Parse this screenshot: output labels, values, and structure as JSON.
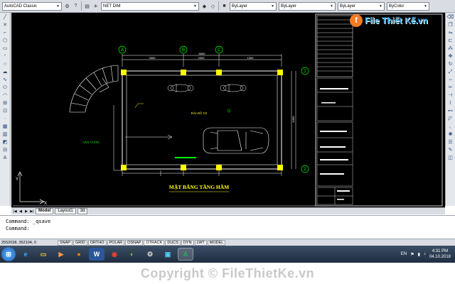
{
  "toolbar": {
    "workspace": "AutoCAD Classic",
    "layer": "NET DIM",
    "linetype_layer": "ByLayer",
    "linetype": "ByLayer",
    "lineweight": "ByLayer",
    "plotstyle": "ByColor"
  },
  "logo": {
    "mark": "f",
    "text": "File Thiết Kế.vn"
  },
  "drawing": {
    "grid_a": "A",
    "grid_b": "B",
    "grid_c": "C",
    "grid_1": "1",
    "grid_2": "2",
    "dim_total": "6600",
    "dim_1": "3300",
    "dim_2": "2000",
    "dim_3": "1300",
    "dim_side": "5400",
    "room_parking": "BÃI ĐỖ XE",
    "room_garden": "SÂN VƯỜN",
    "plan_title": "MẶT BẰNG TẦNG HẦM"
  },
  "tabs": {
    "model": "Model",
    "layout1": "Layout1",
    "layout2": "3d"
  },
  "cmdline": {
    "line1": "Command: _qsave",
    "line2": "Command:"
  },
  "status": {
    "coords": "2552038, 352104, 0",
    "snap": "SNAP",
    "grid": "GRID",
    "ortho": "ORTHO",
    "polar": "POLAR",
    "osnap": "OSNAP",
    "otrack": "OTRACK",
    "ducs": "DUCS",
    "dyn": "DYN",
    "lwt": "LWT",
    "model": "MODEL"
  },
  "taskbar": {
    "apps": [
      "start-orb",
      "ie",
      "explorer",
      "media",
      "firefox",
      "word",
      "chrome",
      "app1",
      "app2",
      "app3",
      "autocad"
    ],
    "lang": "EN",
    "time": "4:31 PM",
    "date": "04.10.2018"
  },
  "footer": {
    "watermark": "Copyright © FileThietKe.vn"
  },
  "colors": {
    "canvas": "#000000",
    "walls": "#ffff00",
    "grid_bubbles": "#00ff00",
    "labels": "#ffff00",
    "dims": "#00ffff"
  }
}
